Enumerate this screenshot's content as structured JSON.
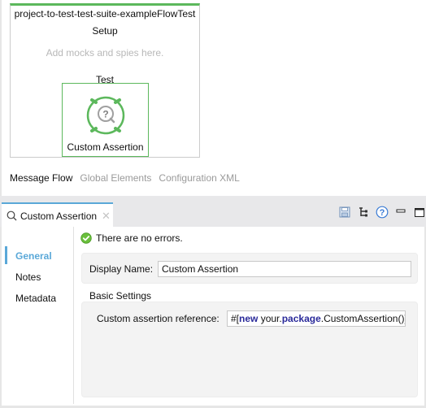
{
  "canvas": {
    "flow_title": "project-to-test-test-suite-exampleFlowTest",
    "setup_label": "Setup",
    "setup_hint": "Add mocks and spies here.",
    "test_label": "Test",
    "component": {
      "label": "Custom Assertion",
      "icon": "custom-assertion-icon"
    },
    "accent_color": "#5cb85c"
  },
  "editor_tabs": [
    {
      "label": "Message Flow",
      "active": true
    },
    {
      "label": "Global Elements",
      "active": false
    },
    {
      "label": "Configuration XML",
      "active": false
    }
  ],
  "properties": {
    "tab": {
      "label": "Custom Assertion",
      "icon": "search-icon",
      "close_icon": "close-icon"
    },
    "toolbar_icons": [
      "save-icon",
      "tree-icon",
      "help-icon",
      "minimize-icon",
      "maximize-icon"
    ],
    "nav": [
      {
        "label": "General",
        "active": true
      },
      {
        "label": "Notes",
        "active": false
      },
      {
        "label": "Metadata",
        "active": false
      }
    ],
    "status": {
      "text": "There are no errors.",
      "icon": "check-circle-icon"
    },
    "display_name": {
      "label": "Display Name:",
      "value": "Custom Assertion"
    },
    "basic_settings": {
      "heading": "Basic Settings",
      "reference_label": "Custom assertion reference:",
      "reference_value": {
        "prefix": "#[",
        "kw1": "new",
        "mid": " your.",
        "kw2": "package",
        "suffix": ".CustomAssertion()]"
      }
    },
    "accent_color": "#5aa8d8"
  }
}
